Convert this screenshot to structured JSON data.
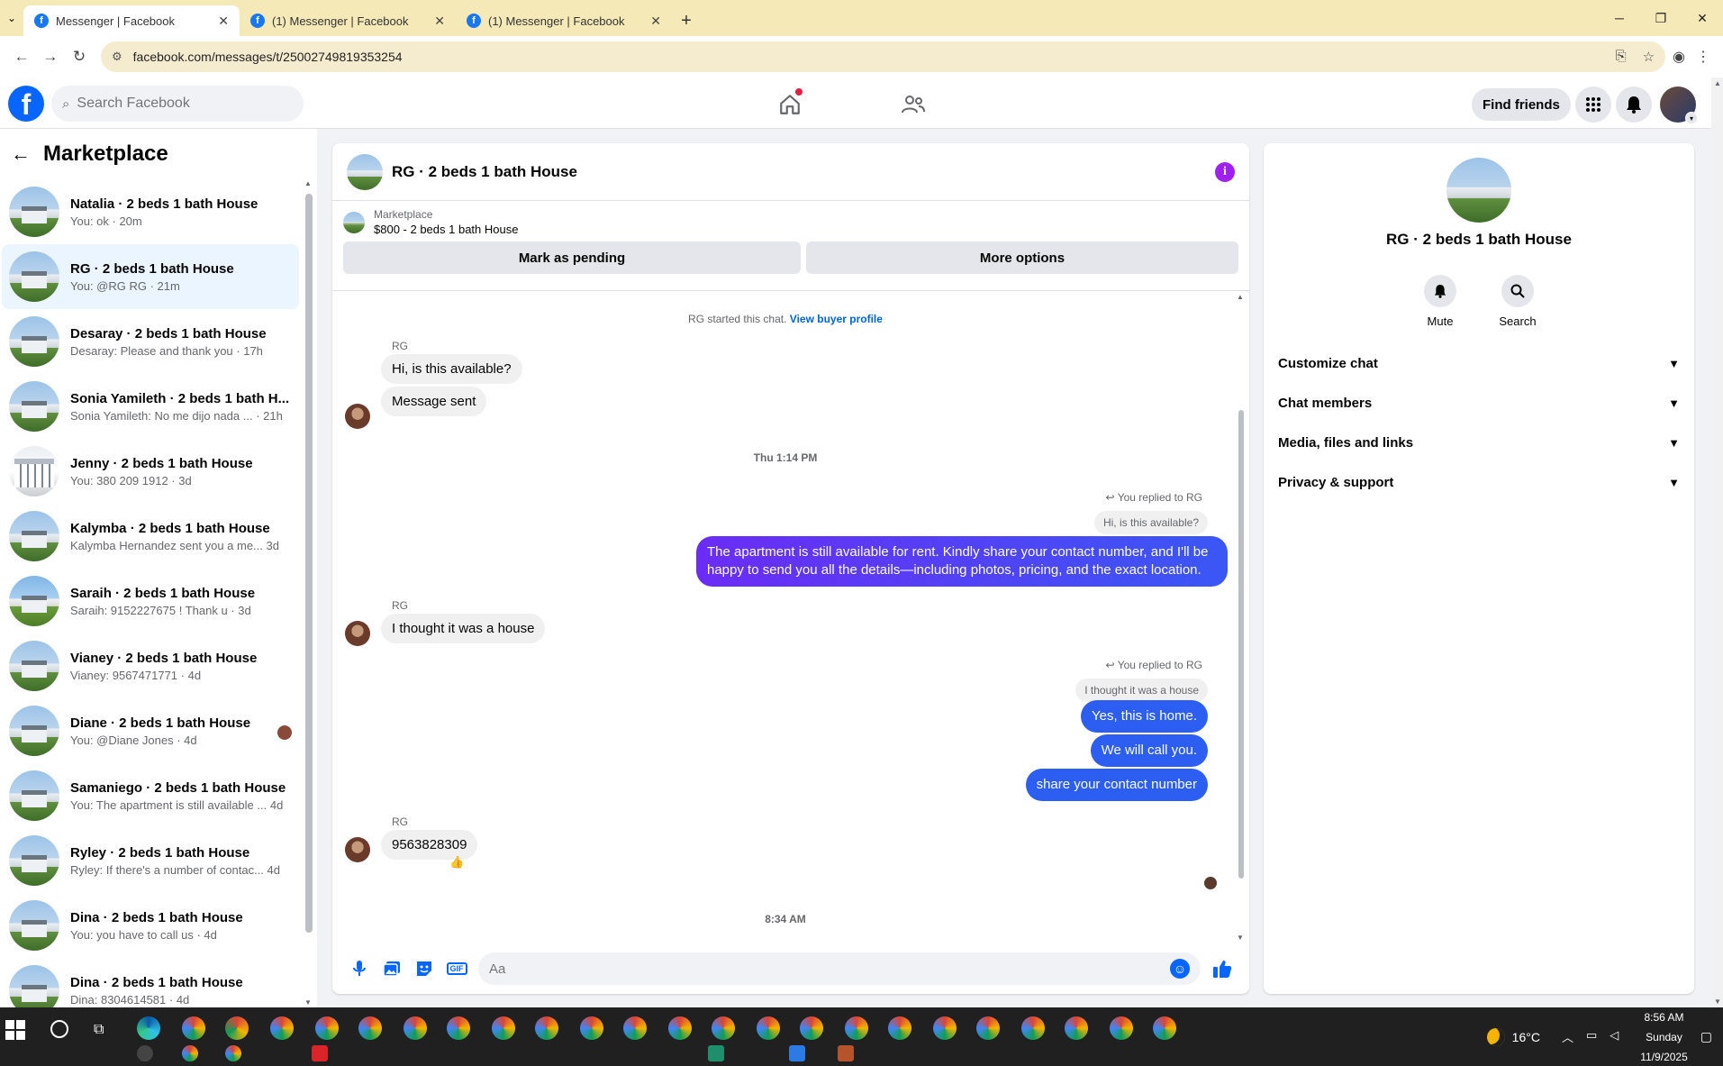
{
  "browser": {
    "tabs": [
      {
        "title": "Messenger | Facebook",
        "active": true
      },
      {
        "title": "(1) Messenger | Facebook",
        "active": false
      },
      {
        "title": "(1) Messenger | Facebook",
        "active": false
      }
    ],
    "url": "facebook.com/messages/t/25002749819353254"
  },
  "header": {
    "search_placeholder": "Search Facebook",
    "find_friends_label": "Find friends"
  },
  "sidebar": {
    "title": "Marketplace",
    "conversations": [
      {
        "name": "Natalia · 2 beds 1 bath House",
        "preview": "You: ok · 20m"
      },
      {
        "name": "RG · 2 beds 1 bath House",
        "preview": "You: @RG RG · 21m"
      },
      {
        "name": "Desaray · 2 beds 1 bath House",
        "preview": "Desaray: Please and thank you · 17h"
      },
      {
        "name": "Sonia Yamileth · 2 beds 1 bath H...",
        "preview": "Sonia Yamileth: No me dijo nada ...  · 21h"
      },
      {
        "name": "Jenny · 2 beds 1 bath House",
        "preview": "You: 380 209 1912 · 3d"
      },
      {
        "name": "Kalymba · 2 beds 1 bath House",
        "preview": "Kalymba Hernandez sent you a me...  3d"
      },
      {
        "name": "Saraih · 2 beds 1 bath House",
        "preview": "Saraih: 9152227675 ! Thank u · 3d"
      },
      {
        "name": "Vianey · 2 beds 1 bath House",
        "preview": "Vianey: 9567471771 · 4d"
      },
      {
        "name": "Diane · 2 beds 1 bath House",
        "preview": "You: @Diane Jones · 4d"
      },
      {
        "name": "Samaniego · 2 beds 1 bath House",
        "preview": "You: The apartment is still available ...  4d"
      },
      {
        "name": "Ryley · 2 beds 1 bath House",
        "preview": "Ryley: If there's a number of contac...  4d"
      },
      {
        "name": "Dina · 2 beds 1 bath House",
        "preview": "You: you have to call us · 4d"
      },
      {
        "name": "Dina · 2 beds 1 bath House",
        "preview": "Dina: 8304614581 · 4d"
      }
    ]
  },
  "chat": {
    "title": "RG · 2 beds 1 bath House",
    "listing_label": "Marketplace",
    "listing_title": "$800 - 2 beds 1 bath House",
    "mark_pending_label": "Mark as pending",
    "more_options_label": "More options",
    "started_text": "RG started this chat.",
    "view_profile_label": "View buyer profile",
    "sender_name": "RG",
    "msg1": "Hi, is this available?",
    "msg2": "Message sent",
    "time1": "Thu 1:14 PM",
    "reply_label": "You replied to RG",
    "quote1": "Hi, is this available?",
    "out1": "The apartment is still available for rent. Kindly share your contact number, and I'll be happy to send you all the details—including photos, pricing, and the exact location.",
    "msg3": "I thought it was a house",
    "quote2": "I thought it was a house",
    "out2": "Yes, this is home.",
    "out3": "We will call you.",
    "out4": "share your contact number",
    "msg4": "9563828309",
    "reaction": "👍",
    "time2": "8:34 AM",
    "composer_placeholder": "Aa"
  },
  "info_panel": {
    "title": "RG · 2 beds 1 bath House",
    "mute_label": "Mute",
    "search_label": "Search",
    "sections": [
      "Customize chat",
      "Chat members",
      "Media, files and links",
      "Privacy & support"
    ]
  },
  "taskbar": {
    "temperature": "16°C",
    "time": "8:56 AM",
    "day": "Sunday",
    "date": "11/9/2025"
  }
}
